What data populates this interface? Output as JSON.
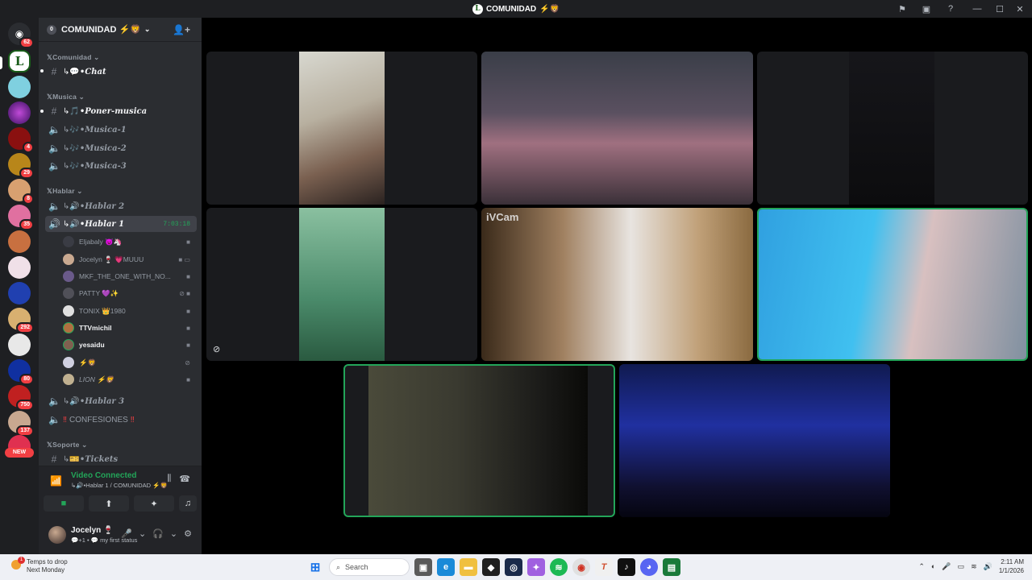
{
  "window": {
    "title": "COMUNIDAD",
    "title_emoji": "⚡🦁"
  },
  "guild_badges": [
    "62",
    "4",
    "29",
    "8",
    "35",
    "292",
    "80",
    "750",
    "137"
  ],
  "new_label": "NEW",
  "server": {
    "name": "COMUNIDAD",
    "emoji": "⚡🦁",
    "boost": "0"
  },
  "categories": {
    "comunidad": "Comunidad",
    "musica": "Musica",
    "hablar": "Hablar",
    "soporte": "Soporte"
  },
  "channels": {
    "chat": "•Chat",
    "poner_musica": "•Poner-musica",
    "musica1": "•Musica-1",
    "musica2": "•Musica-2",
    "musica3": "•Musica-3",
    "hablar2": "•Hablar 2",
    "hablar1": "•Hablar 1",
    "hablar1_timer": "7:03:18",
    "hablar3": "•Hablar 3",
    "confesiones": "CONFESIONES",
    "tickets": "•Tickets"
  },
  "voice_users": [
    {
      "name": "Eljabaly 😈🦄"
    },
    {
      "name": "Jocelyn 🍷 💗MUUU"
    },
    {
      "name": "MKF_THE_ONE_WITH_NO..."
    },
    {
      "name": "PATTY 💜✨"
    },
    {
      "name": "TONIX 👑1980"
    },
    {
      "name": "TTVmichil"
    },
    {
      "name": "yesaidu"
    },
    {
      "name": "⚡🦁"
    },
    {
      "name": "LION ⚡🦁"
    }
  ],
  "voice_connection": {
    "status": "Video Connected",
    "location": "↳🔊•Hablar 1 / COMUNIDAD ⚡🦁"
  },
  "user": {
    "name": "Jocelyn 🍷",
    "status": "💬+1 • 💬 my first status"
  },
  "tiles": {
    "ivcam_label": "iVCam"
  },
  "taskbar": {
    "weather_line1": "Temps to drop",
    "weather_line2": "Next Monday",
    "weather_badge": "1",
    "search_placeholder": "Search",
    "time": "2:11 AM",
    "date": "1/1/2026"
  },
  "colors": {
    "accent_green": "#23a559",
    "sidebar": "#2b2d31",
    "guild_bar": "#1e1f22"
  }
}
